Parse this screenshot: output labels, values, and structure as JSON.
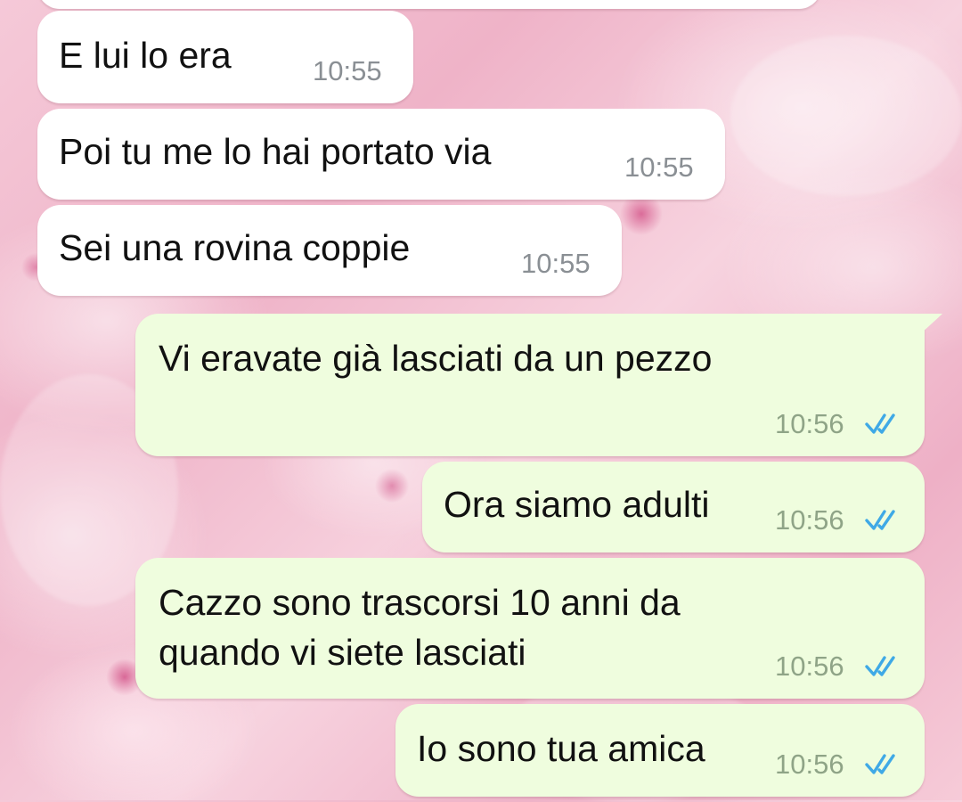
{
  "messages": [
    {
      "direction": "incoming",
      "text": "E lui lo era",
      "time": "10:55"
    },
    {
      "direction": "incoming",
      "text": "Poi tu me lo hai portato via",
      "time": "10:55"
    },
    {
      "direction": "incoming",
      "text": "Sei una rovina coppie",
      "time": "10:55"
    },
    {
      "direction": "outgoing",
      "text": "Vi eravate già lasciati da un pezzo",
      "time": "10:56",
      "status": "read"
    },
    {
      "direction": "outgoing",
      "text": "Ora siamo adulti",
      "time": "10:56",
      "status": "read"
    },
    {
      "direction": "outgoing",
      "text_line1": "Cazzo sono trascorsi 10 anni da",
      "text_line2": "quando vi siete lasciati",
      "time": "10:56",
      "status": "read"
    },
    {
      "direction": "outgoing",
      "text": "Io sono tua amica",
      "time": "10:56",
      "status": "read"
    }
  ],
  "colors": {
    "incoming_bubble": "#ffffff",
    "outgoing_bubble": "#effdde",
    "read_ticks": "#3fa9e6"
  },
  "icons": {
    "read_status": "double-check-icon"
  }
}
